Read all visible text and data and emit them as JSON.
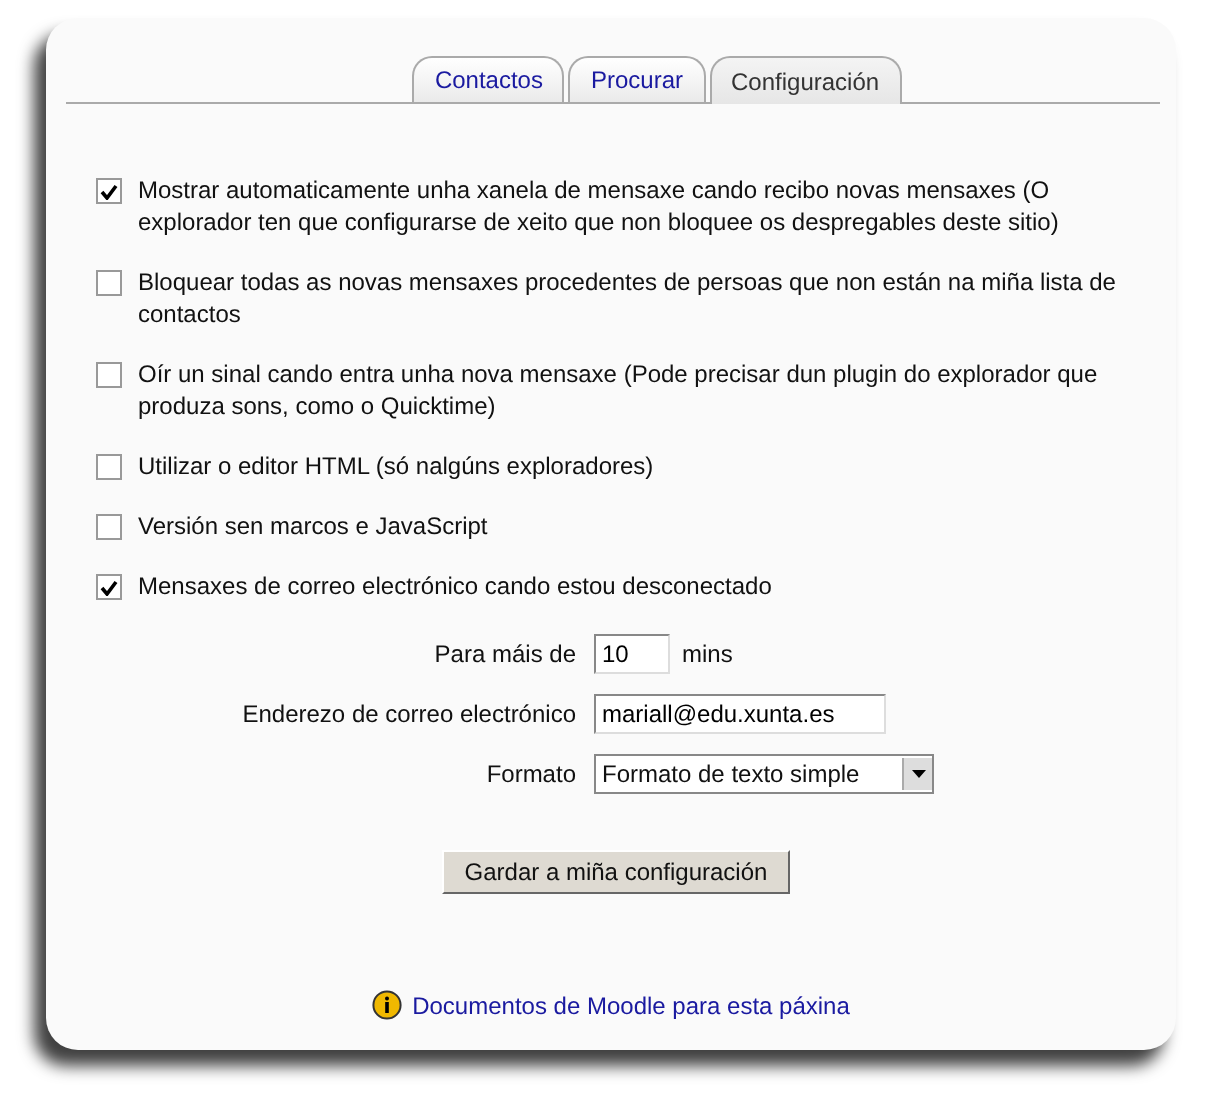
{
  "tabs": [
    {
      "label": "Contactos",
      "selected": false
    },
    {
      "label": "Procurar",
      "selected": false
    },
    {
      "label": "Configuración",
      "selected": true
    }
  ],
  "options": [
    {
      "label": "Mostrar automaticamente unha xanela de mensaxe cando recibo novas mensaxes (O explorador ten que configurarse de xeito que non bloquee os despregables deste sitio)",
      "checked": true
    },
    {
      "label": "Bloquear todas as novas mensaxes procedentes de persoas que non están na miña lista de contactos",
      "checked": false
    },
    {
      "label": "Oír un sinal cando entra unha nova mensaxe (Pode precisar dun plugin do explorador que produza sons, como o Quicktime)",
      "checked": false
    },
    {
      "label": "Utilizar o editor HTML (só nalgúns exploradores)",
      "checked": false
    },
    {
      "label": "Versión sen marcos e JavaScript",
      "checked": false
    },
    {
      "label": "Mensaxes de correo electrónico cando estou desconectado",
      "checked": true
    }
  ],
  "fields": [
    {
      "kind": "text",
      "label": "Para máis de",
      "value": "10",
      "unit": "mins"
    },
    {
      "kind": "email",
      "label": "Enderezo de correo electrónico",
      "value": "mariall@edu.xunta.es"
    },
    {
      "kind": "select",
      "label": "Formato",
      "value": "Formato de texto simple"
    }
  ],
  "save_button": "Gardar a miña configuración",
  "help_link": "Documentos de Moodle para esta páxina"
}
